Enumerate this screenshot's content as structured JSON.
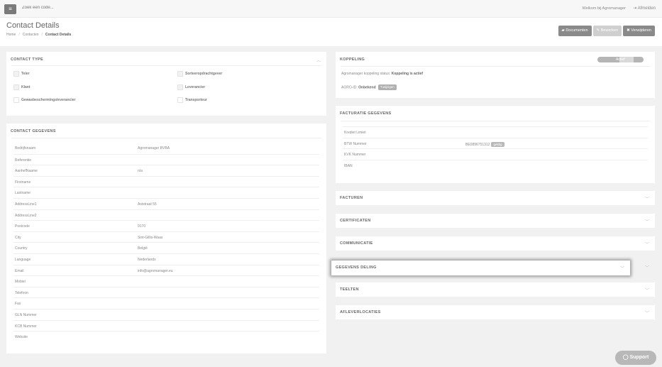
{
  "topbar": {
    "menu_icon": "hamburger-icon",
    "search_placeholder": "Zoek een code...",
    "welcome_text": "Welkom bij Agromanager",
    "logout_label": "Afmelden"
  },
  "header": {
    "title": "Contact Details",
    "breadcrumb": [
      "Home",
      "Contacten",
      "Contact Details"
    ],
    "buttons": {
      "documents": "Documenten",
      "edit": "Bewerken",
      "delete": "Verwijderen"
    }
  },
  "contact_type": {
    "title": "CONTACT TYPE",
    "options": [
      {
        "label": "Teler"
      },
      {
        "label": "Sorteeropdrachtgever"
      },
      {
        "label": "Klant"
      },
      {
        "label": "Leverancier"
      },
      {
        "label": "Gewasbeschermingsleverancier"
      },
      {
        "label": "Transporteur"
      }
    ]
  },
  "contact_gegevens": {
    "title": "CONTACT GEGEVENS",
    "rows": [
      {
        "key": "Bedrijfsnaam",
        "value": "Agromanager BVBA"
      },
      {
        "key": "Referentie",
        "value": ""
      },
      {
        "key": "AanhefNaame",
        "value": "n/a"
      },
      {
        "key": "Firstname",
        "value": ""
      },
      {
        "key": "Lastname",
        "value": ""
      },
      {
        "key": "AddressLine1",
        "value": "Aststraat 55"
      },
      {
        "key": "AddressLine2",
        "value": ""
      },
      {
        "key": "Postcode",
        "value": "9170"
      },
      {
        "key": "City",
        "value": "Sint-Gillis-Waas"
      },
      {
        "key": "Country",
        "value": "België"
      },
      {
        "key": "Language",
        "value": "Nederlands"
      },
      {
        "key": "Email",
        "value": "info@agromanager.eu"
      },
      {
        "key": "Mobiel",
        "value": ""
      },
      {
        "key": "Telefoon",
        "value": ""
      },
      {
        "key": "Fax",
        "value": ""
      },
      {
        "key": "GLN Nummer",
        "value": ""
      },
      {
        "key": "KCB Nummer",
        "value": ""
      },
      {
        "key": "Website",
        "value": ""
      }
    ]
  },
  "koppeling": {
    "title": "KOPPELING",
    "toggle_label": "Actief",
    "status_prefix": "Agromanager koppeling status:",
    "status_value": "Koppeling is actief",
    "agro_id_label": "AGRO-ID:",
    "agro_id_value": "Onbekend",
    "agro_id_button": "wijzigen"
  },
  "facturatie": {
    "title": "FACTURATIE GEGEVENS",
    "rows": [
      {
        "key": "Krediet Limiet",
        "value": ""
      },
      {
        "key": "BTW Nummer",
        "value": "BE0896751312",
        "badge": "geldig"
      },
      {
        "key": "KVK Nummer",
        "value": ""
      },
      {
        "key": "IBAN",
        "value": ""
      }
    ]
  },
  "sections": [
    {
      "title": "FACTUREN"
    },
    {
      "title": "CERTIFICATEN"
    },
    {
      "title": "COMMUNICATIE"
    },
    {
      "title": "GEGEVENS DELING"
    },
    {
      "title": "TEELTEN"
    },
    {
      "title": "AFLEVERLOCATIES"
    }
  ],
  "support_label": "Support"
}
